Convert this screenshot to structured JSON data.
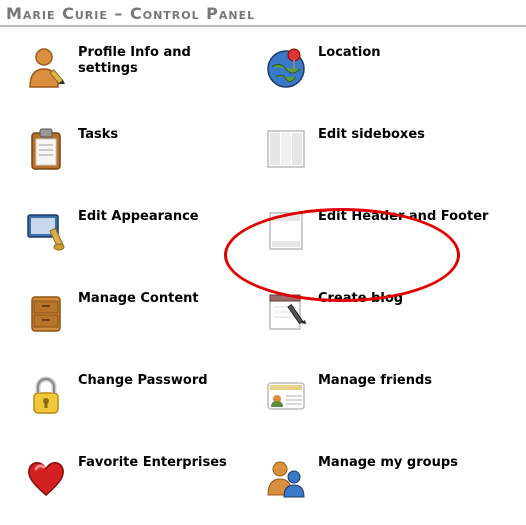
{
  "header": {
    "title": "Marie Curie – Control Panel"
  },
  "items": {
    "profile": {
      "label": "Profile Info and settings",
      "icon": "person-edit-icon"
    },
    "location": {
      "label": "Location",
      "icon": "globe-pin-icon"
    },
    "tasks": {
      "label": "Tasks",
      "icon": "clipboard-icon"
    },
    "sideboxes": {
      "label": "Edit sideboxes",
      "icon": "columns-page-icon"
    },
    "appearance": {
      "label": "Edit Appearance",
      "icon": "brush-theme-icon"
    },
    "header_footer": {
      "label": "Edit Header and Footer",
      "icon": "page-layout-icon"
    },
    "content": {
      "label": "Manage Content",
      "icon": "archive-drawer-icon"
    },
    "blog": {
      "label": "Create blog",
      "icon": "notepad-pen-icon"
    },
    "password": {
      "label": "Change Password",
      "icon": "lock-icon"
    },
    "friends": {
      "label": "Manage friends",
      "icon": "id-card-icon"
    },
    "favorites": {
      "label": "Favorite Enterprises",
      "icon": "heart-icon"
    },
    "groups": {
      "label": "Manage my groups",
      "icon": "users-group-icon"
    }
  },
  "highlight": "header_footer"
}
